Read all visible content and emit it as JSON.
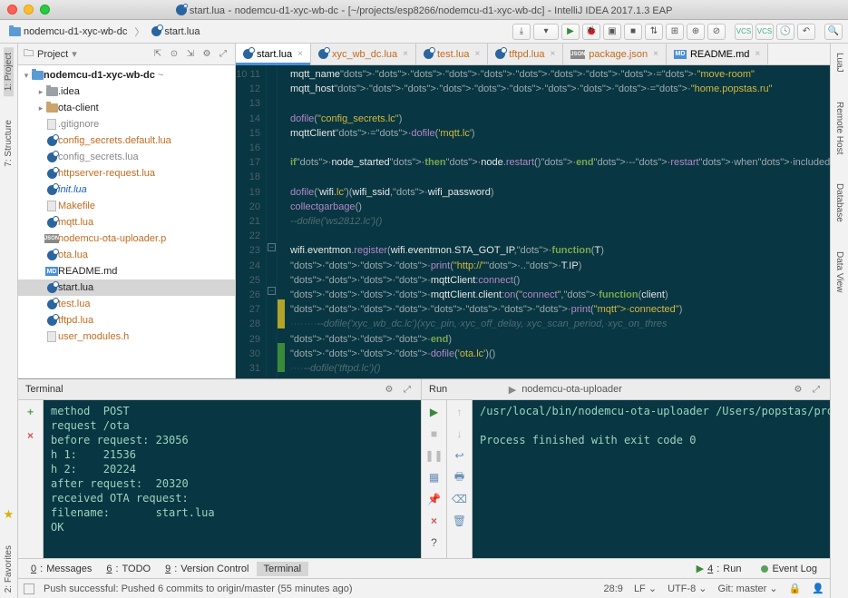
{
  "window": {
    "title_file": "start.lua",
    "title_project": "nodemcu-d1-xyc-wb-dc",
    "title_path": "[~/projects/esp8266/nodemcu-d1-xyc-wb-dc]",
    "title_app": "IntelliJ IDEA 2017.1.3 EAP"
  },
  "breadcrumb": {
    "project": "nodemcu-d1-xyc-wb-dc",
    "file": "start.lua"
  },
  "rails": {
    "left": [
      "1: Project",
      "7: Structure"
    ],
    "left_bottom": "2: Favorites",
    "right": [
      "LuaJ",
      "Remote Host",
      "Database",
      "Data View"
    ]
  },
  "project_panel": {
    "title": "Project",
    "root": "nodemcu-d1-xyc-wb-dc",
    "items": [
      {
        "indent": 1,
        "arrow": "▸",
        "type": "dir-grey",
        "label": ".idea"
      },
      {
        "indent": 1,
        "arrow": "▸",
        "type": "dir",
        "label": "ota-client"
      },
      {
        "indent": 1,
        "arrow": "",
        "type": "file",
        "label": ".gitignore",
        "cls": "grey"
      },
      {
        "indent": 1,
        "arrow": "",
        "type": "lua",
        "label": "config_secrets.default.lua",
        "cls": "orange"
      },
      {
        "indent": 1,
        "arrow": "",
        "type": "lua",
        "label": "config_secrets.lua",
        "cls": "grey"
      },
      {
        "indent": 1,
        "arrow": "",
        "type": "lua",
        "label": "httpserver-request.lua",
        "cls": "orange"
      },
      {
        "indent": 1,
        "arrow": "",
        "type": "lua",
        "label": "init.lua",
        "cls": "blue"
      },
      {
        "indent": 1,
        "arrow": "",
        "type": "file",
        "label": "Makefile",
        "cls": "orange"
      },
      {
        "indent": 1,
        "arrow": "",
        "type": "lua",
        "label": "mqtt.lua",
        "cls": "orange"
      },
      {
        "indent": 1,
        "arrow": "",
        "type": "json",
        "label": "nodemcu-ota-uploader.p",
        "cls": "orange"
      },
      {
        "indent": 1,
        "arrow": "",
        "type": "lua",
        "label": "ota.lua",
        "cls": "orange"
      },
      {
        "indent": 1,
        "arrow": "",
        "type": "md",
        "label": "README.md"
      },
      {
        "indent": 1,
        "arrow": "",
        "type": "lua",
        "label": "start.lua",
        "sel": true
      },
      {
        "indent": 1,
        "arrow": "",
        "type": "lua",
        "label": "test.lua",
        "cls": "orange"
      },
      {
        "indent": 1,
        "arrow": "",
        "type": "lua",
        "label": "tftpd.lua",
        "cls": "orange"
      },
      {
        "indent": 1,
        "arrow": "",
        "type": "file",
        "label": "user_modules.h",
        "cls": "orange"
      }
    ]
  },
  "tabs": [
    {
      "icon": "lua",
      "label": "start.lua",
      "active": true
    },
    {
      "icon": "lua",
      "label": "xyc_wb_dc.lua",
      "cls": "orange"
    },
    {
      "icon": "lua",
      "label": "test.lua",
      "cls": "orange"
    },
    {
      "icon": "lua",
      "label": "tftpd.lua",
      "cls": "orange"
    },
    {
      "icon": "json",
      "label": "package.json",
      "cls": "orange"
    },
    {
      "icon": "md",
      "label": "README.md"
    }
  ],
  "editor": {
    "first_line": 10,
    "lines": [
      "mqtt_name·········=·\"move-room\"",
      "mqtt_host·········=·\"home.popstas.ru\"",
      "",
      "dofile(\"config_secrets.lc\")",
      "mqttClient·=·dofile('mqtt.lc')",
      "",
      "if·node_started·then·node.restart()·end·--·restart·when·included·after·start",
      "",
      "dofile('wifi.lc')(wifi_ssid,·wifi_password)",
      "collectgarbage()",
      "--dofile('ws2812.lc')()",
      "",
      "wifi.eventmon.register(wifi.eventmon.STA_GOT_IP,·function(T)",
      "····print(\"http://\"·..·T.IP)",
      "····mqttClient:connect()",
      "····mqttClient.client:on(\"connect\",·function(client)",
      "········print(\"mqtt·connected\")",
      "········--dofile('xyc_wb_dc.lc')(xyc_pin,·xyc_off_delay,·xyc_scan_period,·xyc_on_thres",
      "····end)",
      "····dofile('ota.lc')()",
      "····--dofile('tftpd.lc')()",
      "····collectgarbage()"
    ]
  },
  "terminal": {
    "title": "Terminal",
    "lines": [
      "method  POST",
      "request /ota",
      "before request: 23056",
      "h 1:    21536",
      "h 2:    20224",
      "after request:  20320",
      "received OTA request:",
      "filename:       start.lua",
      "OK",
      ""
    ]
  },
  "run": {
    "title": "Run",
    "config": "nodemcu-ota-uploader",
    "arrow": "▶",
    "lines": [
      "/usr/local/bin/nodemcu-ota-uploader /Users/popstas/proj",
      "",
      "Process finished with exit code 0"
    ]
  },
  "tool_tabs": {
    "left": [
      {
        "num": "0",
        "label": "Messages"
      },
      {
        "num": "6",
        "label": "TODO"
      },
      {
        "num": "9",
        "label": "Version Control"
      },
      {
        "label": "Terminal",
        "sel": true
      }
    ],
    "right": [
      {
        "num": "4",
        "label": "Run",
        "play": true
      },
      {
        "label": "Event Log",
        "dot": true
      }
    ]
  },
  "status": {
    "msg": "Push successful: Pushed 6 commits to origin/master (55 minutes ago)",
    "pos": "28:9",
    "enc": "LF",
    "cs": "UTF-8",
    "git": "Git: master"
  }
}
